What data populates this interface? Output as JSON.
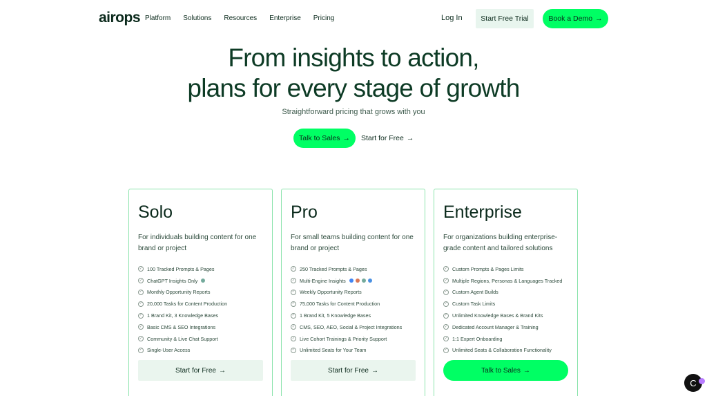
{
  "nav": {
    "logo": "airops",
    "links": [
      "Platform",
      "Solutions",
      "Resources",
      "Enterprise",
      "Pricing"
    ],
    "login": "Log In",
    "trial": "Start Free Trial",
    "demo": "Book a Demo"
  },
  "hero": {
    "line1": "From insights to action,",
    "line2": "plans for every stage of growth",
    "subtitle": "Straightforward pricing that grows with you",
    "cta_primary": "Talk to Sales",
    "cta_secondary": "Start for Free"
  },
  "plans": [
    {
      "name": "Solo",
      "description": "For individuals building content for one brand or project",
      "features": [
        "100 Tracked Prompts & Pages",
        "ChatGPT Insights Only",
        "Monthly Opportunity Reports",
        "20,000 Tasks for Content Production",
        "1 Brand Kit, 3 Knowledge Bases",
        "Basic CMS & SEO Integrations",
        "Community & Live Chat Support",
        "Single-User Access"
      ],
      "button": "Start for Free"
    },
    {
      "name": "Pro",
      "description": "For small teams building content for one brand or project",
      "features": [
        "250 Tracked Prompts & Pages",
        "Multi-Engine Insights",
        "Weekly Opportunity Reports",
        "75,000 Tasks for Content Production",
        "1 Brand Kit, 5 Knowledge Bases",
        "CMS, SEO, AEO, Social & Project Integrations",
        "Live Cohort Trainings & Priority Support",
        "Unlimited Seats for Your Team"
      ],
      "button": "Start for Free"
    },
    {
      "name": "Enterprise",
      "description": "For organizations building enterprise-grade content and tailored solutions",
      "features": [
        "Custom Prompts & Pages Limits",
        "Multiple Regions, Personas & Languages Tracked",
        "Custom Agent Builds",
        "Custom Task Limits",
        "Unlimited Knowledge Bases & Brand Kits",
        "Dedicated Account Manager & Training",
        "1:1 Expert Onboarding",
        "Unlimited Seats & Collaboration Functionality"
      ],
      "button": "Talk to Sales"
    }
  ],
  "icons": {
    "arrow": "→",
    "check": "✓",
    "chat": "C"
  },
  "colors": {
    "accent": "#00ff64",
    "text_dark": "#0b2a1c",
    "card_border": "#8be3ac",
    "secondary_btn": "#eaf5ee"
  }
}
